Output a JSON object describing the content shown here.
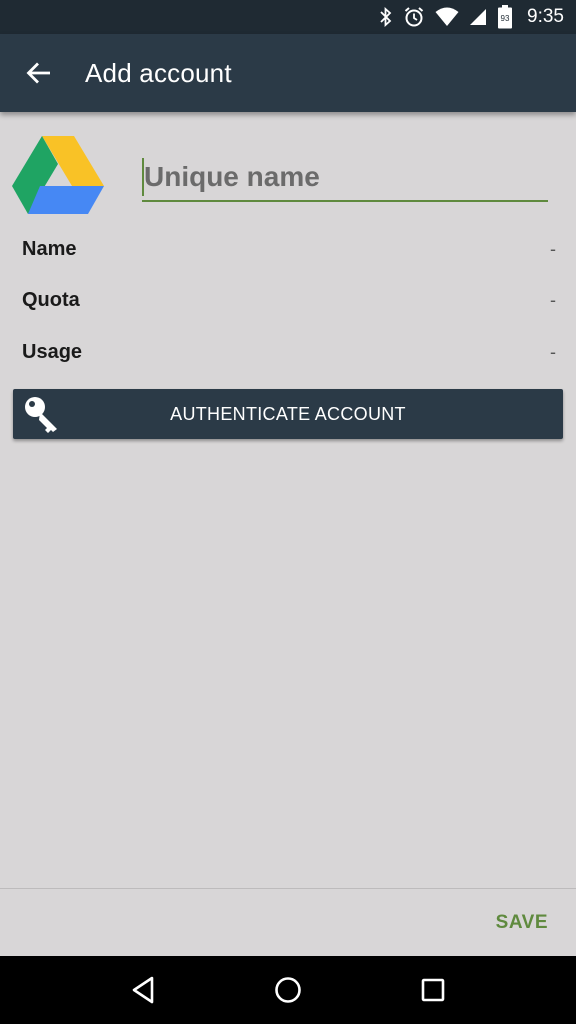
{
  "status_bar": {
    "time": "9:35",
    "battery_level": "93",
    "icons": [
      "bluetooth-icon",
      "alarm-icon",
      "wifi-icon",
      "signal-icon",
      "battery-icon"
    ]
  },
  "app_bar": {
    "title": "Add account",
    "back_icon": "arrow-left-icon"
  },
  "form": {
    "name_field": {
      "placeholder": "Unique name",
      "value": ""
    },
    "logo": "google-drive-logo",
    "info": [
      {
        "label": "Name",
        "value": "-"
      },
      {
        "label": "Quota",
        "value": "-"
      },
      {
        "label": "Usage",
        "value": "-"
      }
    ],
    "authenticate_button": {
      "label": "AUTHENTICATE ACCOUNT",
      "icon": "key-icon"
    }
  },
  "footer": {
    "save_label": "SAVE"
  },
  "nav_bar": {
    "icons": [
      "back-triangle-icon",
      "home-circle-icon",
      "recents-square-icon"
    ]
  },
  "colors": {
    "status_bar": "#1f2a33",
    "app_bar": "#2b3a47",
    "background": "#d8d6d7",
    "accent_green": "#5f8a3e",
    "button_dark": "#2b3a47"
  }
}
